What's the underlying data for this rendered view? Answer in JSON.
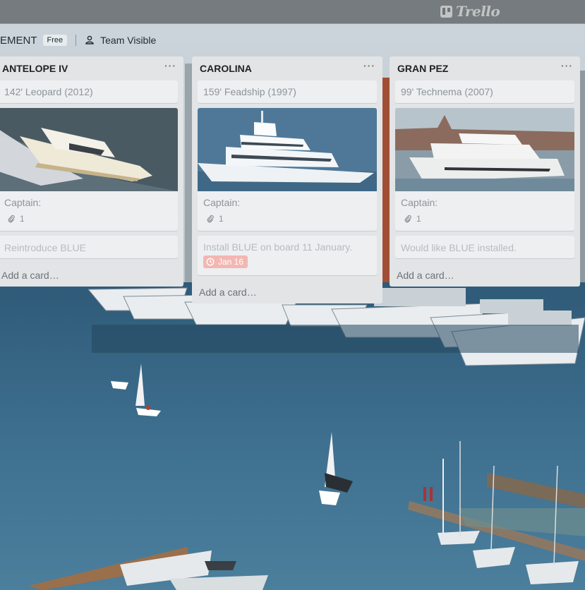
{
  "header": {
    "logo_text": "Trello"
  },
  "board": {
    "name": "EMENT",
    "plan_badge": "Free",
    "visibility": "Team Visible"
  },
  "lists": [
    {
      "title": "ANTELOPE IV",
      "menu": "···",
      "cards": [
        {
          "text": "142' Leopard (2012)"
        },
        {
          "label": "Captain:",
          "attachments": "1"
        },
        {
          "text": "Reintroduce BLUE"
        }
      ],
      "add_card": "Add a card…"
    },
    {
      "title": "CAROLINA",
      "menu": "···",
      "cards": [
        {
          "text": "159' Feadship (1997)"
        },
        {
          "label": "Captain:",
          "attachments": "1"
        },
        {
          "text": "Install BLUE on board 11 January.",
          "due": "Jan 16"
        }
      ],
      "add_card": "Add a card…"
    },
    {
      "title": "GRAN PEZ",
      "menu": "···",
      "cards": [
        {
          "text": "99' Technema (2007)"
        },
        {
          "label": "Captain:",
          "attachments": "1"
        },
        {
          "text": "Would like BLUE installed."
        }
      ],
      "add_card": "Add a card…"
    }
  ],
  "colors": {
    "list_bg": "#e2e4e6",
    "card_bg": "#edeff1",
    "due_badge": "#f3b7b2",
    "topbar": "#6e7376"
  }
}
